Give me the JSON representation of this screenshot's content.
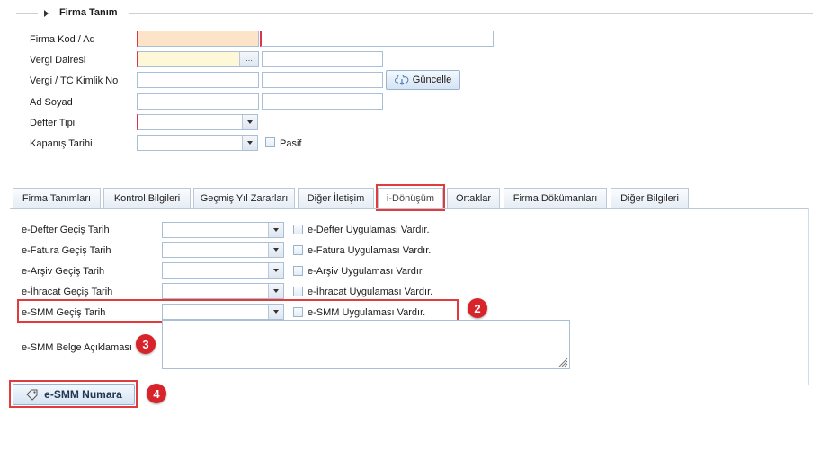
{
  "section": {
    "title": "Firma Tanım"
  },
  "form": {
    "firma_kod_ad": {
      "label": "Firma Kod / Ad"
    },
    "vergi_dairesi": {
      "label": "Vergi Dairesi",
      "lookup_glyph": "..."
    },
    "vergi_tc": {
      "label": "Vergi / TC Kimlik No",
      "update_button": "Güncelle"
    },
    "ad_soyad": {
      "label": "Ad Soyad"
    },
    "defter_tipi": {
      "label": "Defter Tipi"
    },
    "kapanis_tarihi": {
      "label": "Kapanış Tarihi",
      "pasif_label": "Pasif"
    }
  },
  "tabs": [
    {
      "label": "Firma Tanımları"
    },
    {
      "label": "Kontrol Bilgileri"
    },
    {
      "label": "Geçmiş Yıl Zararları"
    },
    {
      "label": "Diğer İletişim"
    },
    {
      "label": "i-Dönüşüm",
      "active": true
    },
    {
      "label": "Ortaklar"
    },
    {
      "label": "Firma Dökümanları"
    },
    {
      "label": "Diğer Bilgileri"
    }
  ],
  "donusum": {
    "rows": [
      {
        "label": "e-Defter Geçiş Tarih",
        "check_label": "e-Defter Uygulaması Vardır."
      },
      {
        "label": "e-Fatura Geçiş Tarih",
        "check_label": "e-Fatura Uygulaması Vardır."
      },
      {
        "label": "e-Arşiv Geçiş Tarih",
        "check_label": "e-Arşiv Uygulaması Vardır."
      },
      {
        "label": "e-İhracat Geçiş Tarih",
        "check_label": "e-İhracat Uygulaması Vardır."
      },
      {
        "label": "e-SMM Geçiş Tarih",
        "check_label": "e-SMM Uygulaması Vardır."
      }
    ],
    "belge_aciklama_label": "e-SMM Belge Açıklaması",
    "numara_button": "e-SMM Numara"
  },
  "annotations": {
    "b2": "2",
    "b3": "3",
    "b4": "4"
  },
  "colors": {
    "highlight": "#e23b3b",
    "badge": "#d8232a",
    "field_border": "#a9bfd6",
    "required": "#e0334a"
  }
}
